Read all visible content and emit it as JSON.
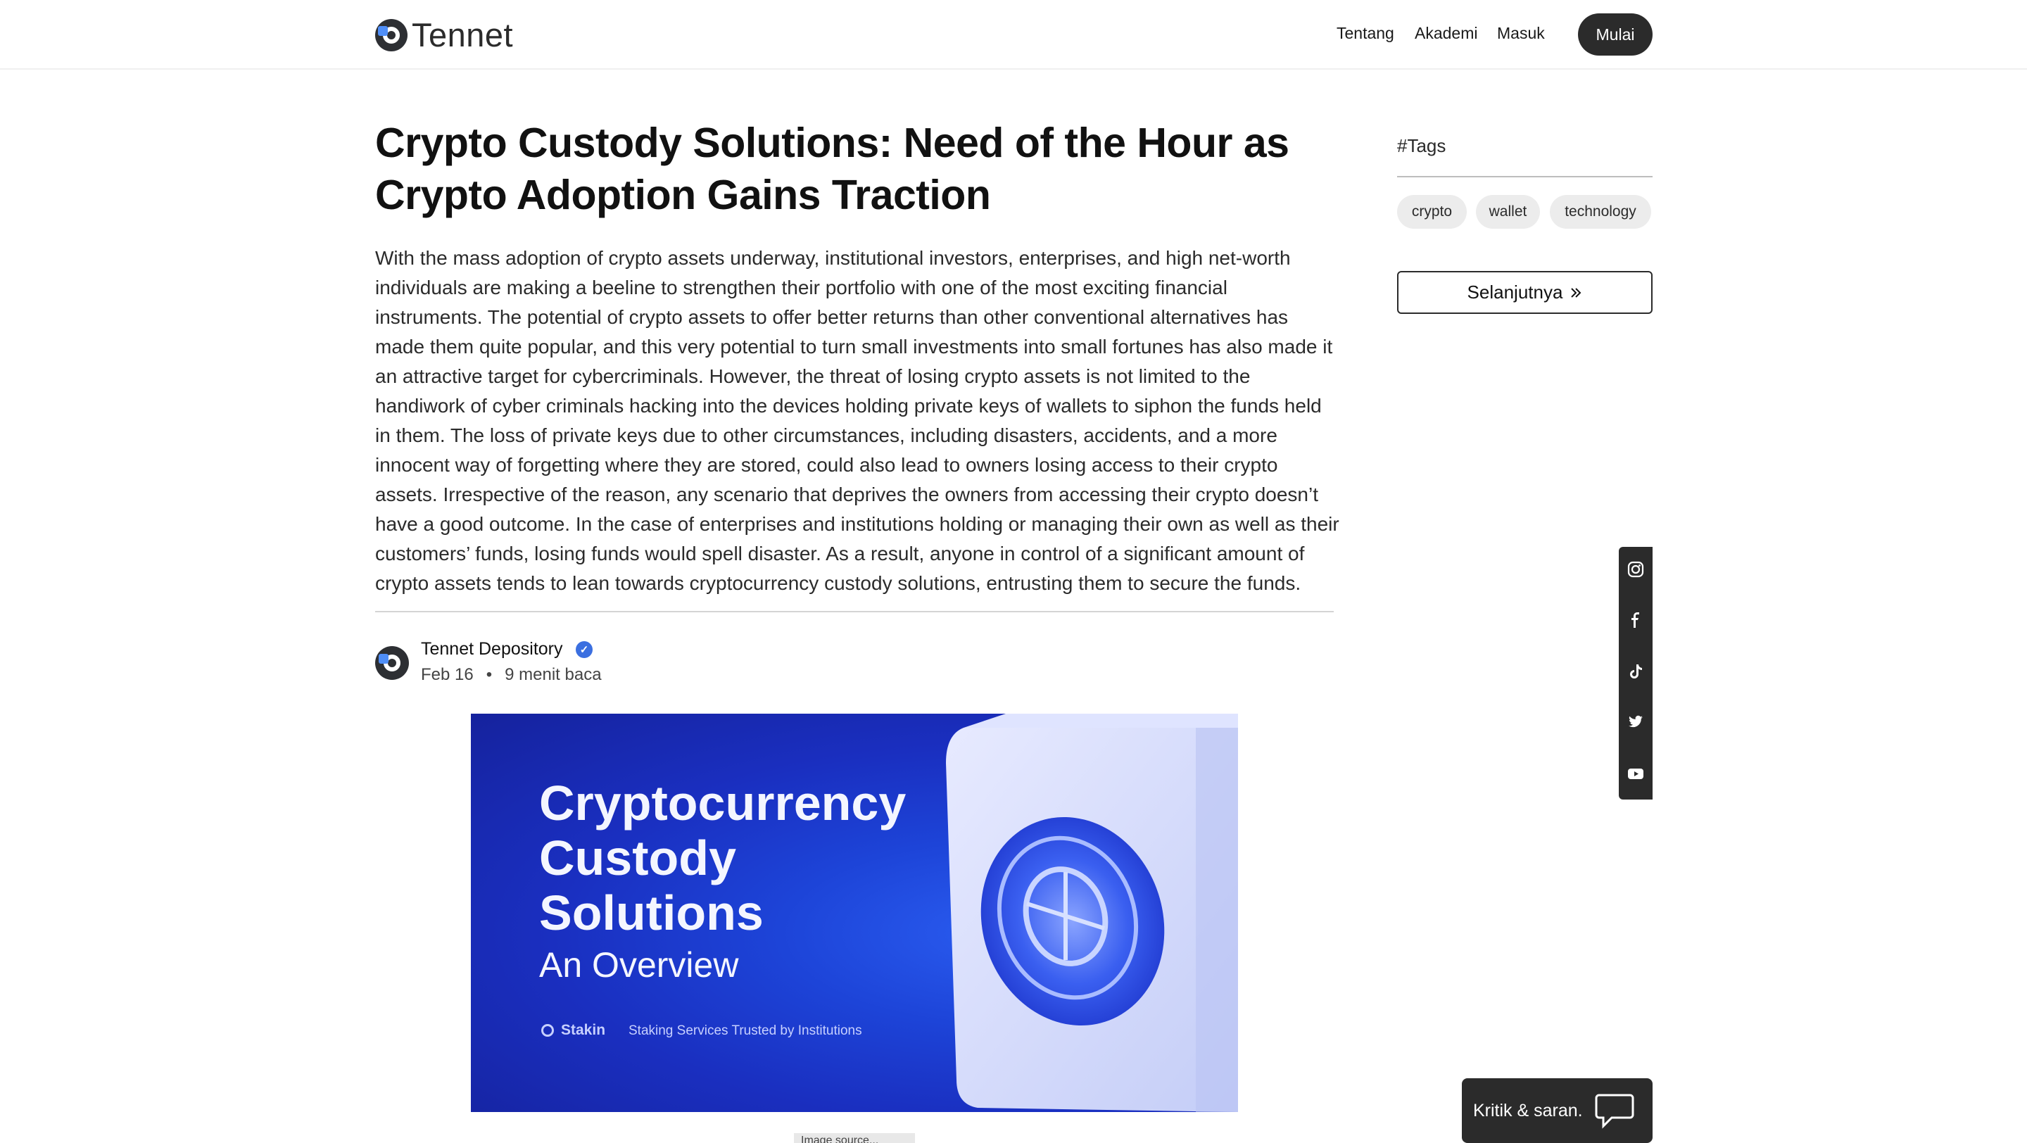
{
  "header": {
    "logo_text": "Tennet",
    "nav": [
      "Tentang",
      "Akademi",
      "Masuk"
    ],
    "cta_label": "Mulai"
  },
  "article": {
    "title": "Crypto Custody Solutions: Need of the Hour as Crypto Adoption Gains Traction",
    "body": "With the mass adoption of crypto assets underway, institutional investors, enterprises, and high net-worth individuals are making a beeline to strengthen their portfolio with one of the most exciting financial instruments. The potential of crypto assets to offer better returns than other conventional alternatives has made them quite popular, and this very potential to turn small investments into small fortunes has also made it an attractive target for cybercriminals. However, the threat of losing crypto assets is not limited to the handiwork of cyber criminals hacking into the devices holding private keys of wallets to siphon the funds held in them. The loss of private keys due to other circumstances, including disasters, accidents, and a more innocent way of forgetting where they are stored, could also lead to owners losing access to their crypto assets. Irrespective of the reason, any scenario that deprives the owners from accessing their crypto doesn’t have a good outcome. In the case of enterprises and institutions holding or managing their own as well as their customers’ funds, losing funds would spell disaster. As a result, anyone in control of a significant amount of crypto assets tends to lean towards cryptocurrency custody solutions, entrusting them to secure the funds.",
    "author": "Tennet Depository",
    "date": "Feb 16",
    "separator": "•",
    "read_time": "9 menit baca",
    "image": {
      "title_line1": "Cryptocurrency",
      "title_line2": "Custody",
      "title_line3": "Solutions",
      "subtitle": "An Overview",
      "brand": "Stakin",
      "tagline": "Staking Services Trusted by Institutions",
      "caption": "Image source..."
    }
  },
  "sidebar": {
    "tags_title": "#Tags",
    "tags": [
      "crypto",
      "wallet",
      "technology"
    ],
    "next_label": "Selanjutnya"
  },
  "social": [
    "instagram-icon",
    "facebook-icon",
    "tiktok-icon",
    "twitter-icon",
    "youtube-icon"
  ],
  "feedback": {
    "label": "Kritik & saran."
  },
  "colors": {
    "dark": "#2b2b2b",
    "accent": "#3b6fe0",
    "hero_blue": "#1d44d8"
  }
}
